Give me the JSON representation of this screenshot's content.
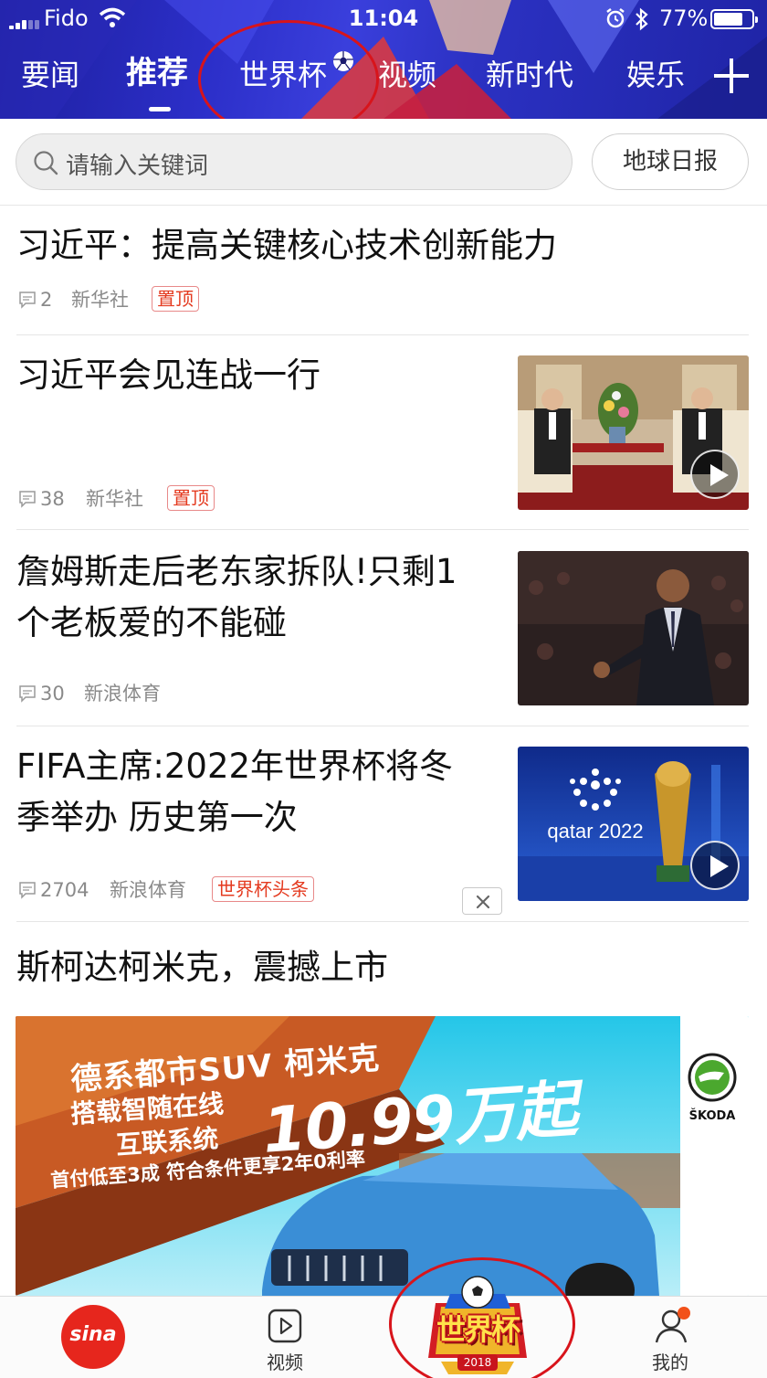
{
  "status_bar": {
    "carrier": "Fido",
    "time": "11:04",
    "battery": "77%",
    "battery_level": 0.77
  },
  "nav": {
    "tabs": [
      {
        "label": "要闻"
      },
      {
        "label": "推荐",
        "active": true
      },
      {
        "label": "世界杯"
      },
      {
        "label": "视频"
      },
      {
        "label": "新时代"
      },
      {
        "label": "娱乐"
      }
    ]
  },
  "search": {
    "placeholder": "请输入关键词",
    "daily_label": "地球日报"
  },
  "feed": [
    {
      "title": "习近平：提高关键核心技术创新能力",
      "comments": "2",
      "source": "新华社",
      "tag": "置顶"
    },
    {
      "title": "习近平会见连战一行",
      "comments": "38",
      "source": "新华社",
      "tag": "置顶",
      "video": true
    },
    {
      "title_line1": "詹姆斯走后老东家拆队!只剩1",
      "title_line2": "个老板爱的不能碰",
      "comments": "30",
      "source": "新浪体育"
    },
    {
      "title_line1": "FIFA主席:2022年世界杯将冬",
      "title_line2": "季举办 历史第一次",
      "comments": "2704",
      "source": "新浪体育",
      "tag": "世界杯头条",
      "video": true,
      "thumb_text": "qatar 2022"
    },
    {
      "title": "斯柯达柯米克，震撼上市"
    }
  ],
  "ad": {
    "line1": "德系都市SUV 柯米克",
    "line2a": "搭载智随在线",
    "line2b": "互联系统",
    "price": "10.99万起",
    "line3": "首付低至3成 符合条件更享2年0利率",
    "brand": "ŠKODA"
  },
  "tabbar": {
    "home_logo": "sina",
    "video_label": "视频",
    "worldcup_label": "世界杯",
    "worldcup_year": "2018",
    "me_label": "我的"
  },
  "colors": {
    "accent": "#e43a1f",
    "header": "#2c2fc9",
    "annotation": "#d8141b"
  }
}
